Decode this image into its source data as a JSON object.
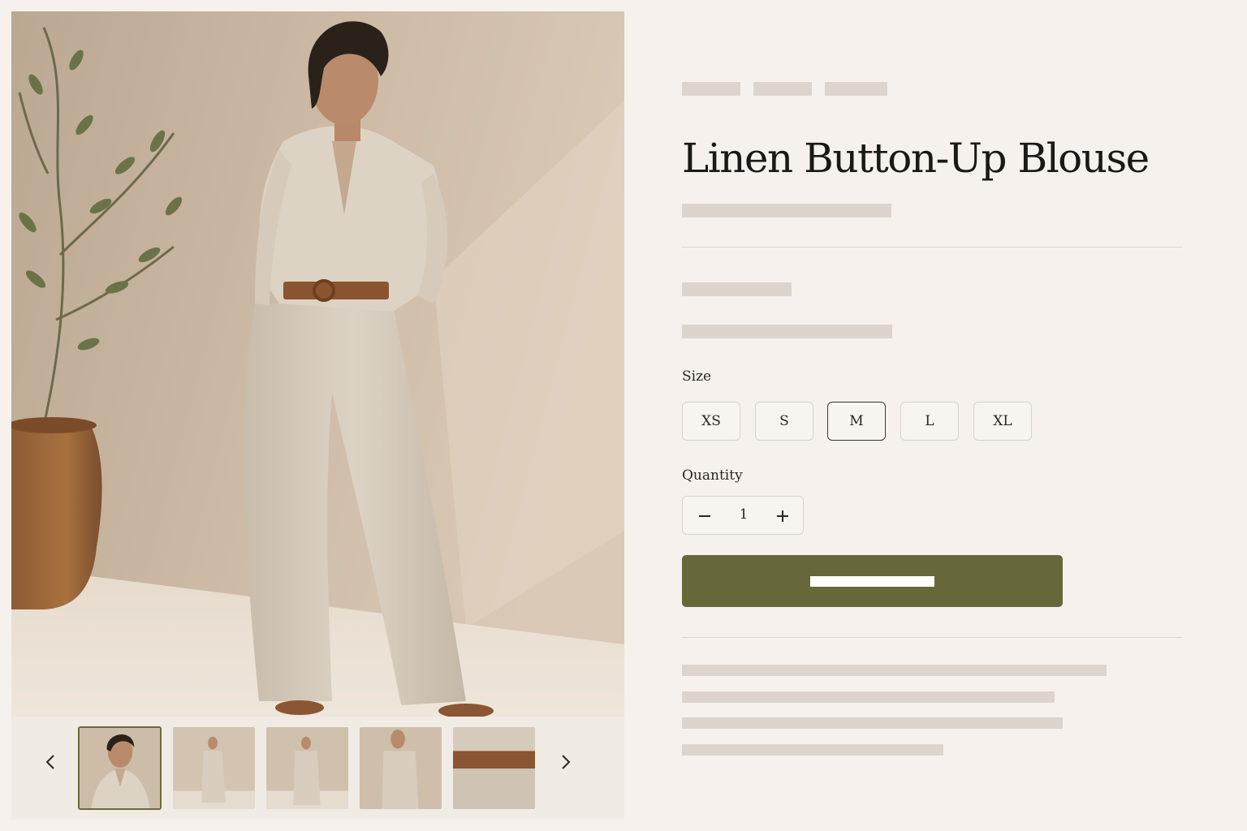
{
  "product": {
    "title": "Linen Button-Up Blouse"
  },
  "gallery": {
    "prev_icon": "chevron-left-icon",
    "next_icon": "chevron-right-icon",
    "thumbnail_count": 5,
    "active_thumbnail": 1
  },
  "size": {
    "label": "Size",
    "options": [
      "XS",
      "S",
      "M",
      "L",
      "XL"
    ],
    "selected": "M"
  },
  "quantity": {
    "label": "Quantity",
    "value": "1",
    "decrement_icon": "minus-icon",
    "increment_icon": "plus-icon"
  },
  "colors": {
    "accent": "#67683a",
    "background": "#f6f1ec",
    "placeholder": "#ddd5cd"
  }
}
